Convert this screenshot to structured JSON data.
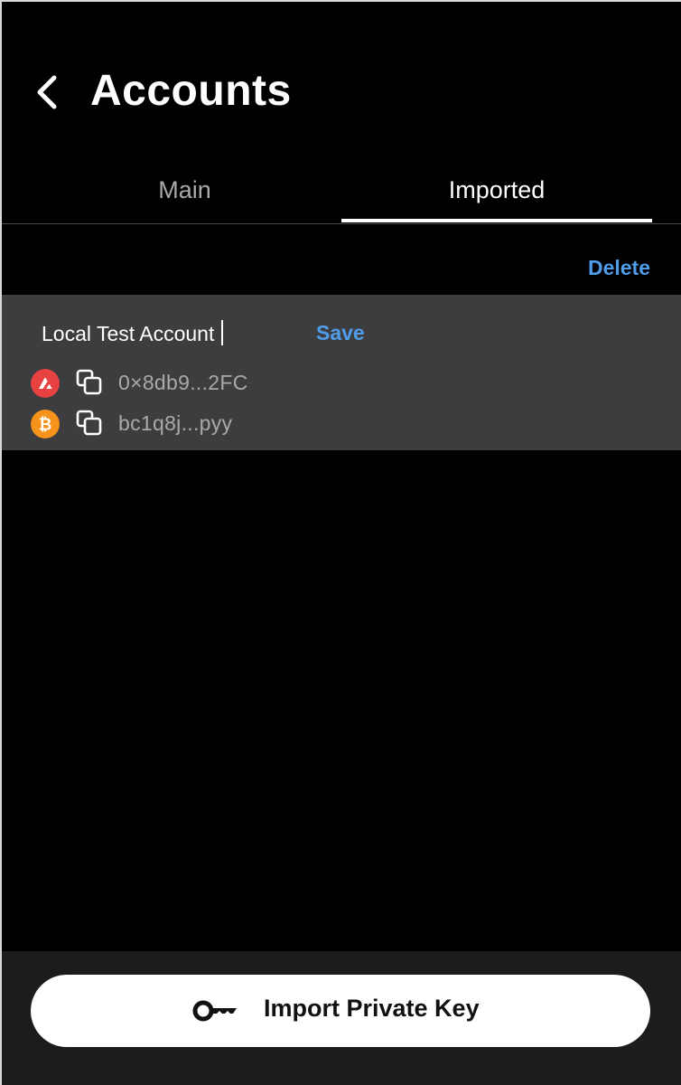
{
  "header": {
    "title": "Accounts"
  },
  "tabs": [
    {
      "label": "Main",
      "active": false
    },
    {
      "label": "Imported",
      "active": true
    }
  ],
  "actions": {
    "delete_label": "Delete",
    "save_label": "Save"
  },
  "account": {
    "name_value": "Local Test Account",
    "addresses": [
      {
        "chain": "avalanche",
        "icon": "avalanche-icon",
        "address": "0×8db9...2FC"
      },
      {
        "chain": "bitcoin",
        "icon": "bitcoin-icon",
        "address": "bc1q8j...pyy"
      }
    ]
  },
  "footer": {
    "import_label": "Import Private Key"
  },
  "colors": {
    "background": "#000000",
    "accent": "#4f9ce9",
    "card": "#3d3d3f",
    "footer": "#1c1c1e",
    "avalanche": "#e84142",
    "bitcoin": "#f7931a"
  }
}
